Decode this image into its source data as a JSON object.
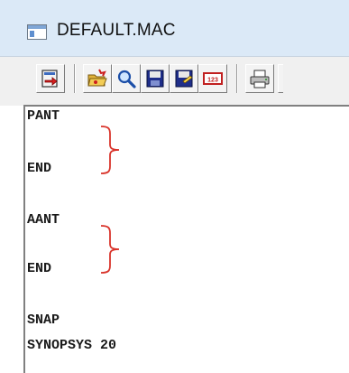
{
  "window": {
    "title": "DEFAULT.MAC"
  },
  "toolbar": {
    "buttons": [
      "exit-icon",
      "open-folder-icon",
      "search-icon",
      "save-icon",
      "save-as-icon",
      "numbers-icon",
      "print-icon"
    ],
    "numbers_label": "123"
  },
  "editor": {
    "lines": [
      "PANT",
      "END",
      "AANT",
      "END",
      "SNAP",
      "SYNOPSYS 20"
    ],
    "annotation_color": "#d9342b"
  },
  "colors": {
    "titlebar": "#dbe9f7",
    "toolbar": "#f0f0f0"
  }
}
